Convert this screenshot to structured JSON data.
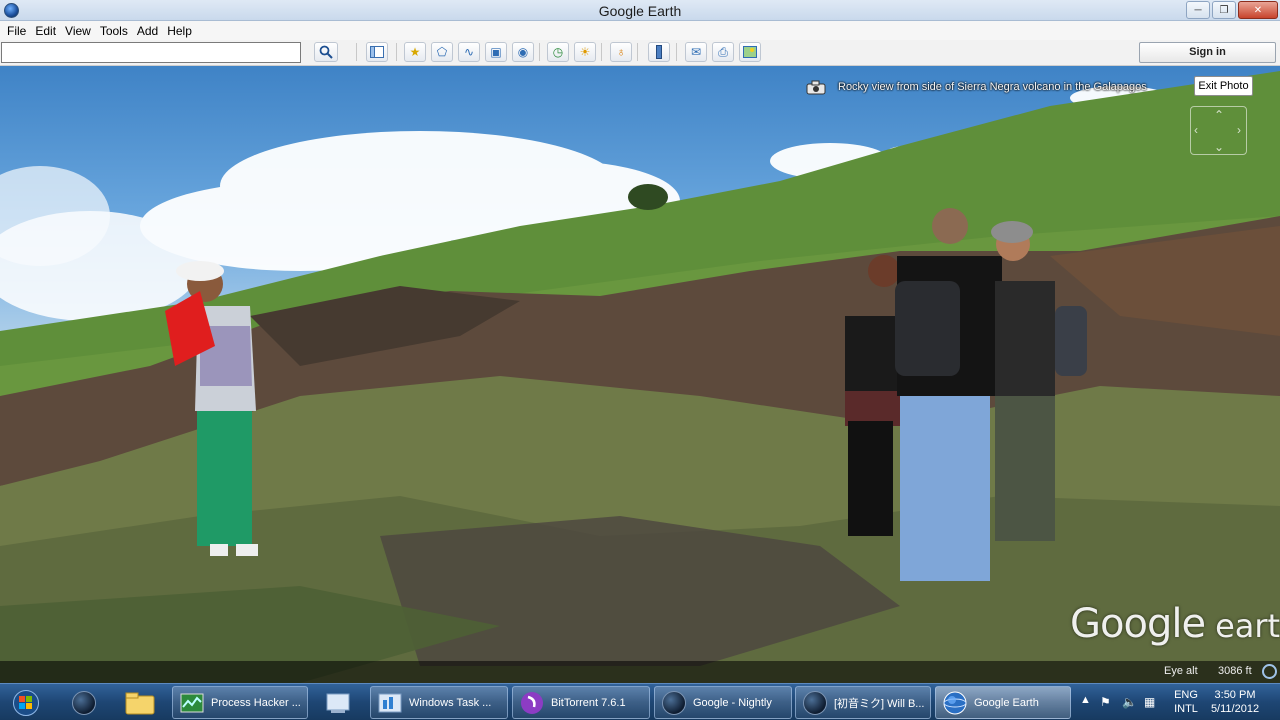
{
  "window": {
    "title": "Google Earth",
    "min_icon": "minimize-icon",
    "max_icon": "maximize-icon",
    "close_icon": "close-icon"
  },
  "menu": [
    "File",
    "Edit",
    "View",
    "Tools",
    "Add",
    "Help"
  ],
  "toolbar": {
    "search_value": "",
    "search_icon": "search-icon",
    "sign_in": "Sign in",
    "buttons": [
      "sidebar-toggle-icon",
      "placemark-icon",
      "polygon-icon",
      "path-icon",
      "image-overlay-icon",
      "record-tour-icon",
      "historical-imagery-icon",
      "sunlight-icon",
      "planets-icon",
      "ruler-icon",
      "email-icon",
      "print-icon",
      "save-image-icon"
    ]
  },
  "photo": {
    "caption": "Rocky view from side of Sierra Negra volcano in the Galapagos",
    "exit_label": "Exit Photo"
  },
  "logo": {
    "google": "Google",
    "earth": "earth"
  },
  "status": {
    "eye_alt_label": "Eye alt",
    "eye_alt_value": "3086 ft"
  },
  "taskbar": {
    "start_icon": "windows-start-icon",
    "tasks": [
      {
        "label": "Process Hacker ...",
        "icon": "process-hacker-icon"
      },
      {
        "label": "Windows Task ...",
        "icon": "task-manager-icon"
      },
      {
        "label": "BitTorrent 7.6.1",
        "icon": "bittorrent-icon"
      },
      {
        "label": "Google - Nightly",
        "icon": "firefox-nightly-icon"
      },
      {
        "label": "[初音ミク] Will B...",
        "icon": "media-player-icon"
      },
      {
        "label": "Google Earth",
        "icon": "google-earth-icon"
      }
    ],
    "tray": {
      "lang_top": "ENG",
      "lang_bottom": "INTL",
      "time": "3:50 PM",
      "date": "5/11/2012"
    }
  }
}
